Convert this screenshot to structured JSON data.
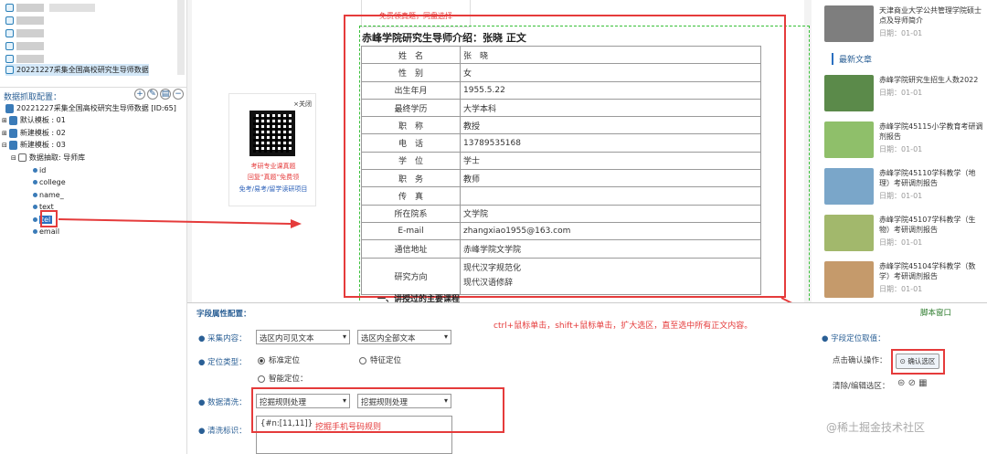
{
  "tree": {
    "top_item": "20221227采集全国高校研究生导师数据",
    "section_label": "数据抓取配置：",
    "root": "20221227采集全国高校研究生导师数据 [ID:65]",
    "templates": [
      "默认模板 : 01",
      "新建模板 : 02",
      "新建模板 : 03"
    ],
    "extract_node": "数据抽取: 导师库",
    "fields": [
      "id",
      "college",
      "name_",
      "text",
      "tel",
      "email"
    ]
  },
  "qr_card": {
    "close": "×关闭",
    "line1": "考研专业课真题",
    "line2": "回复“真题”免费领",
    "line3": "免考/易考/留学读研项目"
  },
  "preview_top": {
    "t1": "免费领真题，同盘选择"
  },
  "doc": {
    "title": "赤峰学院研究生导师介绍：张晓 正文",
    "rows": [
      {
        "label": "姓　名",
        "value": "张　晓"
      },
      {
        "label": "性　别",
        "value": "女"
      },
      {
        "label": "出生年月",
        "value": "1955.5.22"
      },
      {
        "label": "最终学历",
        "value": "大学本科"
      },
      {
        "label": "职　称",
        "value": "教授"
      },
      {
        "label": "电　话",
        "value": "13789535168"
      },
      {
        "label": "学　位",
        "value": "学士"
      },
      {
        "label": "职　务",
        "value": "教师"
      },
      {
        "label": "传　真",
        "value": ""
      },
      {
        "label": "所在院系",
        "value": "文学院"
      },
      {
        "label": "E-mail",
        "value": "zhangxiao1955@163.com"
      },
      {
        "label": "通信地址",
        "value": "赤峰学院文学院"
      }
    ],
    "research_label": "研究方向",
    "research_values": [
      "现代汉字规范化",
      "现代汉语修辞"
    ],
    "section": "一、讲授过的主要课程"
  },
  "sidebar": {
    "top_article": {
      "title": "天津商业大学公共管理学院硕士点及导师简介",
      "date": "日期：01-01"
    },
    "latest_label": "最新文章",
    "articles": [
      {
        "title": "赤峰学院研究生招生人数2022",
        "date": "日期：01-01",
        "color": "#5b8a4a"
      },
      {
        "title": "赤峰学院45115小学教育考研调剂报告",
        "date": "日期：01-01",
        "color": "#8fbf6a"
      },
      {
        "title": "赤峰学院45110学科教学（地理）考研调剂报告",
        "date": "日期：01-01",
        "color": "#7aa6c9"
      },
      {
        "title": "赤峰学院45107学科教学（生物）考研调剂报告",
        "date": "日期：01-01",
        "color": "#a2b86c"
      },
      {
        "title": "赤峰学院45104学科教学（数学）考研调剂报告",
        "date": "日期：01-01",
        "color": "#c59a6b"
      }
    ]
  },
  "config": {
    "header": "字段属性配置：",
    "script_link": "脚本窗口",
    "collect_label": "采集内容：",
    "collect_opt1": "选区内可见文本",
    "collect_opt2": "选区内全部文本",
    "locate_label": "定位类型：",
    "locate_std": "标准定位",
    "locate_feature": "特征定位",
    "locate_smart": "智能定位：",
    "clean_label": "数据清洗：",
    "clean_opt1": "挖掘规则处理",
    "clean_opt2": "挖掘规则处理",
    "mark_label": "清洗标识：",
    "mark_value": "{#n:[11,11]}",
    "mark_note": "挖掘手机号码规则",
    "instruction": "ctrl+鼠标单击，shift+鼠标单击，扩大选区，直至选中所有正文内容。",
    "locate_value_label": "字段定位取值：",
    "confirm_label": "点击确认操作：",
    "confirm_button": "确认选区",
    "clear_label": "清除/编辑选区："
  },
  "watermark": "@稀土掘金技术社区"
}
